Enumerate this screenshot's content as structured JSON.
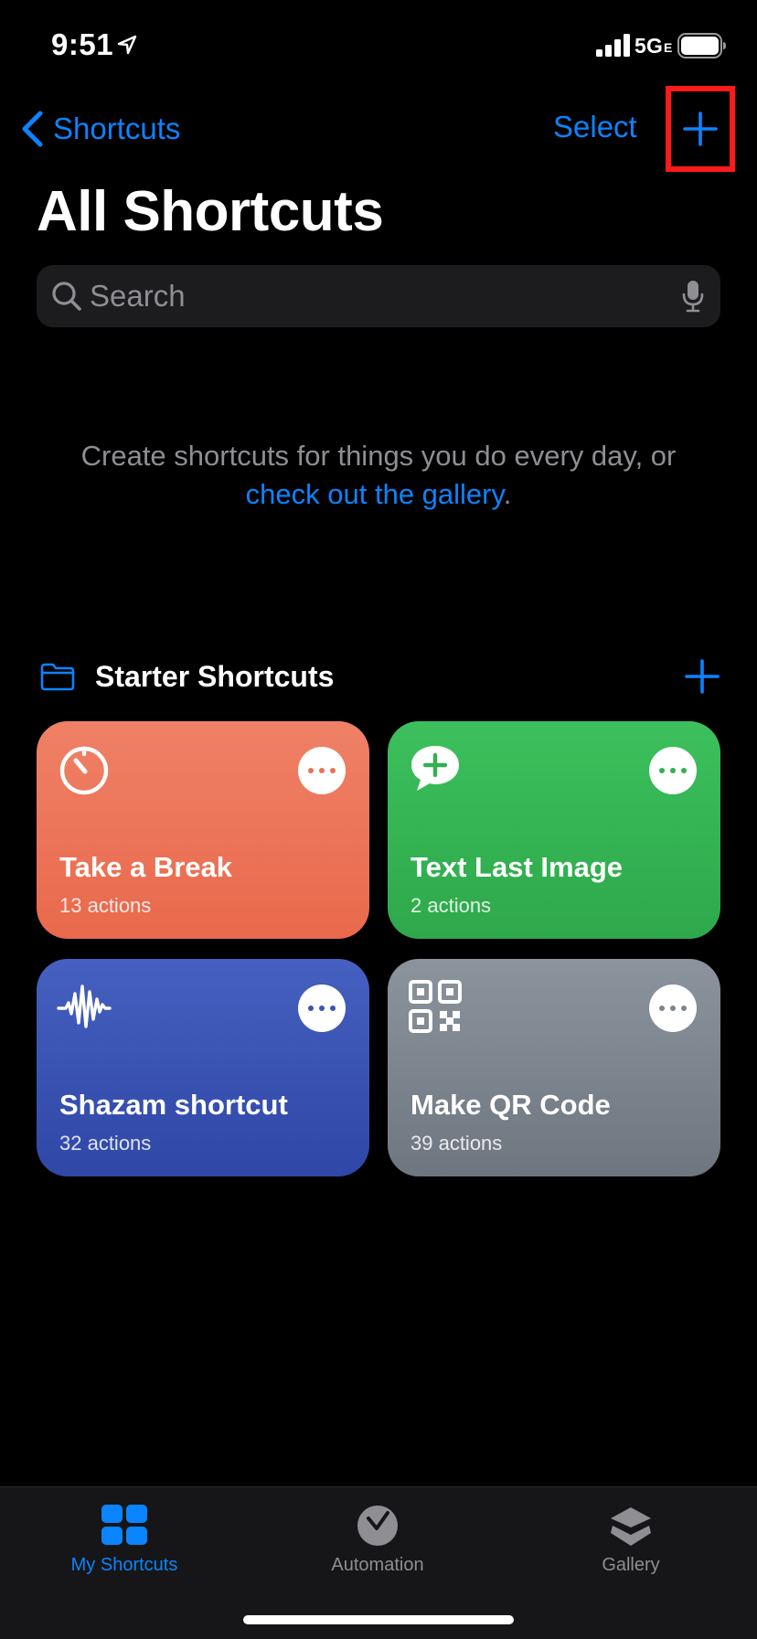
{
  "status_bar": {
    "time": "9:51",
    "network": "5G",
    "network_sub": "E"
  },
  "nav": {
    "back_label": "Shortcuts",
    "select_label": "Select"
  },
  "page": {
    "title": "All Shortcuts"
  },
  "search": {
    "placeholder": "Search"
  },
  "empty_state": {
    "text": "Create shortcuts for things you do every day, or",
    "link": "check out the gallery",
    "suffix": "."
  },
  "folder": {
    "title": "Starter Shortcuts"
  },
  "cards": [
    {
      "title": "Take a Break",
      "subtitle": "13 actions",
      "icon": "timer-icon",
      "color": "#ea7255"
    },
    {
      "title": "Text Last Image",
      "subtitle": "2 actions",
      "icon": "message-add-icon",
      "color": "#33b052"
    },
    {
      "title": "Shazam shortcut",
      "subtitle": "32 actions",
      "icon": "waveform-icon",
      "color": "#3a52b3"
    },
    {
      "title": "Make QR Code",
      "subtitle": "39 actions",
      "icon": "qr-code-icon",
      "color": "#7c848e"
    }
  ],
  "tab_bar": {
    "tabs": [
      {
        "label": "My Shortcuts",
        "icon": "grid-icon",
        "active": true
      },
      {
        "label": "Automation",
        "icon": "clock-check-icon",
        "active": false
      },
      {
        "label": "Gallery",
        "icon": "layers-icon",
        "active": false
      }
    ]
  },
  "colors": {
    "accent": "#0a84ff",
    "highlight_box": "#ff1a1a",
    "background": "#000000"
  }
}
